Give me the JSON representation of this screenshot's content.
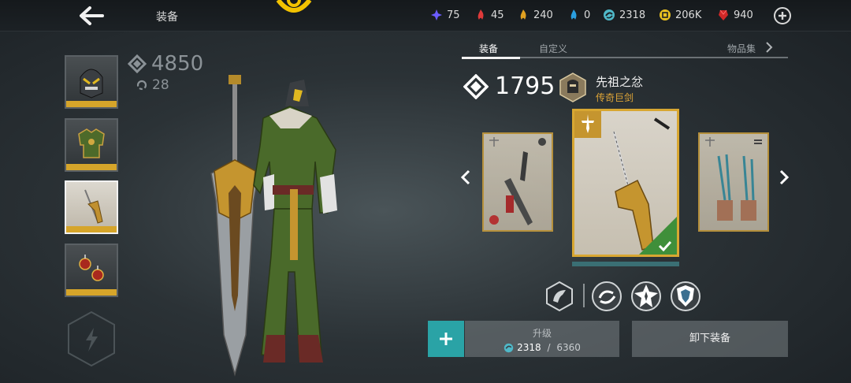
{
  "header": {
    "title": "装备",
    "resources": [
      {
        "icon": "blue-gem-icon",
        "value": "75",
        "color": "#6b5cff"
      },
      {
        "icon": "red-flame-icon",
        "value": "45",
        "color": "#e03a3a"
      },
      {
        "icon": "gold-flame-icon",
        "value": "240",
        "color": "#e0a020"
      },
      {
        "icon": "blue-flame-icon",
        "value": "0",
        "color": "#2a9fe0"
      },
      {
        "icon": "teal-swirl-icon",
        "value": "2318",
        "color": "#4fb8c8"
      },
      {
        "icon": "gold-coin-icon",
        "value": "206K",
        "color": "#e8c020"
      },
      {
        "icon": "ruby-icon",
        "value": "940",
        "color": "#d02828"
      }
    ]
  },
  "character": {
    "power": "4850",
    "level": "28"
  },
  "tabs": [
    {
      "label": "装备",
      "active": true
    },
    {
      "label": "自定义",
      "active": false
    },
    {
      "label": "物品集",
      "active": false
    }
  ],
  "weapon": {
    "power": "1795",
    "name": "先祖之忿",
    "rarity": "传奇巨剑"
  },
  "actions": {
    "upgrade_label": "升级",
    "upgrade_current": "2318",
    "upgrade_separator": " / ",
    "upgrade_required": "6360",
    "unequip_label": "卸下装备"
  },
  "colors": {
    "accent_gold": "#d6a52a",
    "equipped_green": "#3f8f3a",
    "plus_teal": "#2aa3a6"
  }
}
